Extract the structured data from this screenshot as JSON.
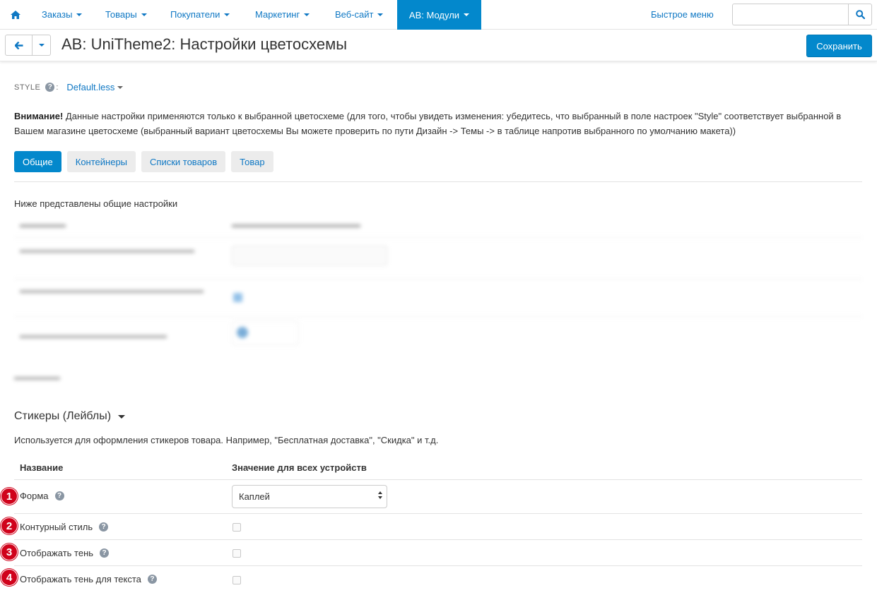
{
  "nav": {
    "items": [
      {
        "label": "Заказы"
      },
      {
        "label": "Товары"
      },
      {
        "label": "Покупатели"
      },
      {
        "label": "Маркетинг"
      },
      {
        "label": "Веб-сайт"
      },
      {
        "label": "AB: Модули"
      }
    ],
    "quick_menu": "Быстрое меню",
    "search_placeholder": "",
    "home_icon": "home-icon",
    "search_icon": "search-icon"
  },
  "titlebar": {
    "title": "AB: UniTheme2: Настройки цветосхемы",
    "save_label": "Сохранить",
    "back_icon": "arrow-left-icon"
  },
  "style": {
    "label": "STYLE",
    "colon": ":",
    "value": "Default.less"
  },
  "warning": {
    "bold": "Внимание!",
    "text": " Данные настройки применяются только к выбранной цветосхеме (для того, чтобы увидеть изменения: убедитесь, что выбранный в поле настроек \"Style\" соответствует выбранной в Вашем магазине цветосхеме (выбранный вариант цветосхемы Вы можете проверить по пути Дизайн -> Темы -> в таблице напротив выбранного по умолчанию макета))"
  },
  "tabs": [
    {
      "label": "Общие",
      "active": true
    },
    {
      "label": "Контейнеры",
      "active": false
    },
    {
      "label": "Списки товаров",
      "active": false
    },
    {
      "label": "Товар",
      "active": false
    }
  ],
  "general_desc": "Ниже представлены общие настройки",
  "stickers": {
    "title": "Стикеры (Лейблы)",
    "desc": "Используется для оформления стикеров товара. Например, \"Бесплатная доставка\", \"Скидка\" и т.д.",
    "col_name": "Название",
    "col_value": "Значение для всех устройств",
    "rows": [
      {
        "marker": "1",
        "label": "Форма",
        "type": "select",
        "value": "Каплей"
      },
      {
        "marker": "2",
        "label": "Контурный стиль",
        "type": "checkbox",
        "checked": false
      },
      {
        "marker": "3",
        "label": "Отображать тень",
        "type": "checkbox",
        "checked": false
      },
      {
        "marker": "4",
        "label": "Отображать тень для текста",
        "type": "checkbox",
        "checked": false
      }
    ]
  },
  "colors": {
    "accent": "#0388cc",
    "link": "#0f78c4",
    "marker": "#d0021b"
  }
}
